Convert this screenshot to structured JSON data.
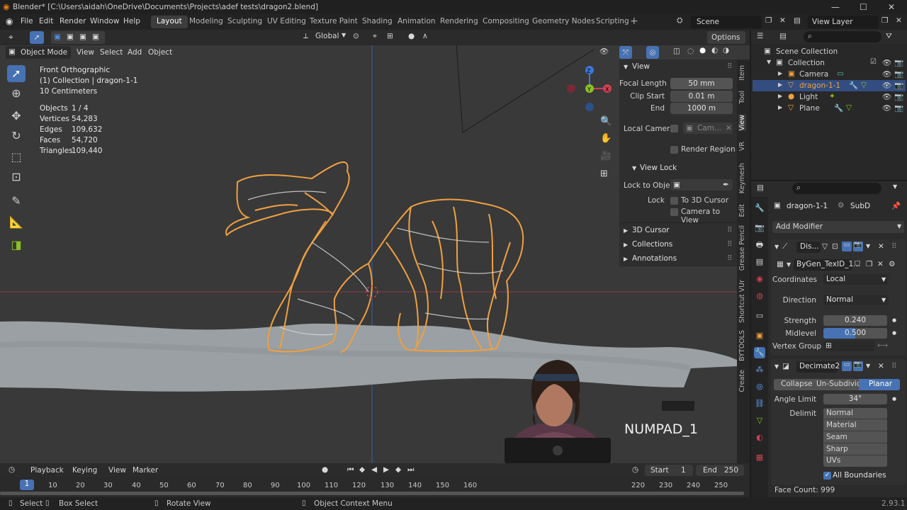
{
  "window": {
    "title": "Blender* [C:\\Users\\aidah\\OneDrive\\Documents\\Projects\\adef tests\\dragon2.blend]",
    "minimize": "—",
    "maximize": "☐",
    "close": "✕"
  },
  "menu": [
    "File",
    "Edit",
    "Render",
    "Window",
    "Help"
  ],
  "workspaces": [
    "Layout",
    "Modeling",
    "Sculpting",
    "UV Editing",
    "Texture Paint",
    "Shading",
    "Animation",
    "Rendering",
    "Compositing",
    "Geometry Nodes",
    "Scripting"
  ],
  "scene": {
    "scene_name": "Scene",
    "view_layer": "View Layer"
  },
  "viewport_header": {
    "orientation": "Global",
    "options": "Options",
    "mode": "Object Mode",
    "menus": [
      "View",
      "Select",
      "Add",
      "Object"
    ]
  },
  "overlay": {
    "view_name": "Front Orthographic",
    "collection": "(1) Collection | dragon-1-1",
    "scale": "10 Centimeters",
    "stats": [
      [
        "Objects",
        "1 / 4"
      ],
      [
        "Vertices",
        "54,283"
      ],
      [
        "Edges",
        "109,632"
      ],
      [
        "Faces",
        "54,720"
      ],
      [
        "Triangles",
        "109,440"
      ]
    ]
  },
  "keystroke": "NUMPAD_1",
  "npanel": {
    "view_header": "View",
    "focal_label": "Focal Length",
    "focal": "50 mm",
    "clip_start_label": "Clip Start",
    "clip_start": "0.01 m",
    "end_label": "End",
    "end": "1000 m",
    "local_camera_label": "Local Camer",
    "local_camera": "Cam...",
    "render_region": "Render Region",
    "view_lock_header": "View Lock",
    "lock_obj_label": "Lock to Obje",
    "lock_label": "Lock",
    "to_cursor": "To 3D Cursor",
    "camera_to_view": "Camera to View",
    "sections": [
      "3D Cursor",
      "Collections",
      "Annotations"
    ],
    "tabs": [
      "Item",
      "Tool",
      "View",
      "VR",
      "Keymesh",
      "Edit",
      "Grease Pencil",
      "Shortcut VUr",
      "BYTOOLS",
      "Create"
    ]
  },
  "outliner": {
    "root": "Scene Collection",
    "collection": "Collection",
    "items": [
      "Camera",
      "dragon-1-1",
      "Light",
      "Plane"
    ]
  },
  "properties": {
    "object": "dragon-1-1",
    "modifier_tag": "SubD",
    "add_modifier": "Add Modifier",
    "displace": {
      "name": "Dis...",
      "texture": "ByGen_TexID_1...",
      "coordinates_label": "Coordinates",
      "coordinates": "Local",
      "direction_label": "Direction",
      "direction": "Normal",
      "strength_label": "Strength",
      "strength": "0.240",
      "midlevel_label": "Midlevel",
      "midlevel": "0.500",
      "midlevel_fill": 0.5,
      "vgroup_label": "Vertex Group"
    },
    "decimate": {
      "name": "Decimate2",
      "modes": [
        "Collapse",
        "Un-Subdivide",
        "Planar"
      ],
      "active_mode": "Planar",
      "angle_label": "Angle Limit",
      "angle": "34°",
      "delimit_label": "Delimit",
      "delimit": [
        "Normal",
        "Material",
        "Seam",
        "Sharp",
        "UVs"
      ],
      "all_boundaries": "All Boundaries",
      "face_count": "Face Count: 999"
    }
  },
  "timeline": {
    "menus": [
      "Playback",
      "Keying",
      "View",
      "Marker"
    ],
    "start_label": "Start",
    "start": "1",
    "end_label": "End",
    "end": "250",
    "current_frame": "1",
    "ticks": [
      "10",
      "20",
      "30",
      "40",
      "50",
      "60",
      "70",
      "80",
      "90",
      "100",
      "110",
      "120",
      "130",
      "140",
      "150",
      "160",
      "220",
      "230",
      "240",
      "250"
    ]
  },
  "status": {
    "select": "Select",
    "box_select": "Box Select",
    "rotate": "Rotate View",
    "context_menu": "Object Context Menu",
    "version": "2.93.1"
  },
  "colors": {
    "accent_blue": "#4772b3",
    "selected_orange": "#f0a040",
    "x_axis": "#d04050",
    "y_axis": "#8cc020",
    "z_axis": "#3a78d8"
  }
}
